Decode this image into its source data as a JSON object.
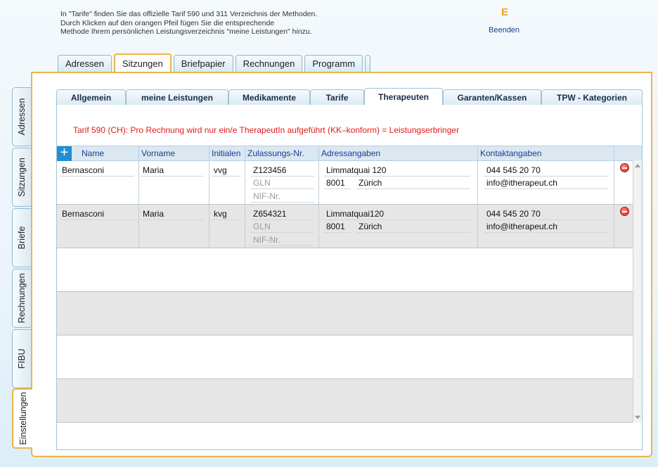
{
  "hint": {
    "line1": "In \"Tarife\" finden Sie das offizielle Tarif 590 und 311 Verzeichnis der Methoden.",
    "line2": "Durch Klicken auf den orangen Pfeil fügen Sie die entsprechende",
    "line3": "Methode Ihrem persönlichen Leistungsverzeichnis \"meine Leistungen\" hinzu."
  },
  "logo_letter": "E",
  "quit_label": "Beenden",
  "top_tabs": [
    "Adressen",
    "Sitzungen",
    "Briefpapier",
    "Rechnungen",
    "Programm"
  ],
  "top_tab_active": "Sitzungen",
  "side_tabs": [
    "Adressen",
    "Sitzungen",
    "Briefe",
    "Rechnungen",
    "FIBU",
    "Einstellungen"
  ],
  "side_tab_active": "Einstellungen",
  "sub_tabs": [
    "Allgemein",
    "meine Leistungen",
    "Medikamente",
    "Tarife",
    "Therapeuten",
    "Garanten/Kassen",
    "TPW - Kategorien"
  ],
  "sub_tab_active": "Therapeuten",
  "notice": "Tarif 590 (CH): Pro Rechnung wird nur ein/e TherapeutIn aufgeführt (KK–konform) = Leistungserbringer",
  "columns": [
    "Name",
    "Vorname",
    "Initialen",
    "Zulassungs-Nr.",
    "Adressangaben",
    "Kontaktangaben"
  ],
  "add_icon": "plus-icon",
  "delete_icon": "minus-circle-icon",
  "placeholders": {
    "gln": "GLN",
    "nif": "NIF-Nr."
  },
  "rows": [
    {
      "name": "Bernasconi",
      "vorname": "Maria",
      "initialen": "vvg",
      "zulassung": "Z123456",
      "gln": "",
      "nif": "",
      "strasse": "Limmatquai 120",
      "plz": "8001",
      "ort": "Zürich",
      "telefon": "044 545 20 70",
      "email": "info@itherapeut.ch"
    },
    {
      "name": "Bernasconi",
      "vorname": "Maria",
      "initialen": "kvg",
      "zulassung": "Z654321",
      "gln": "",
      "nif": "",
      "strasse": "Limmatquai120",
      "plz": "8001",
      "ort": "Zürich",
      "telefon": "044 545 20 70",
      "email": "info@itherapeut.ch"
    }
  ],
  "colors": {
    "accent": "#f0b24a",
    "notice": "#e01b1b",
    "link": "#1a3d8f",
    "add": "#1e8fd4"
  }
}
